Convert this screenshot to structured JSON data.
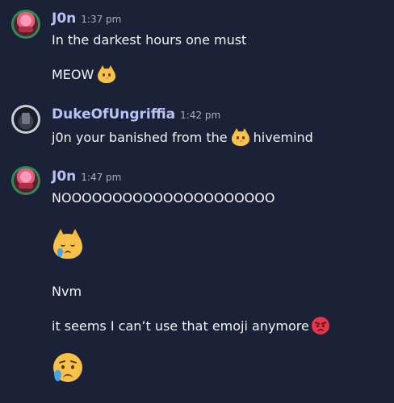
{
  "colors": {
    "background": "#1b2238",
    "username": "#b7c3f3",
    "timestamp": "#aab0bd",
    "text": "#f2f3f5"
  },
  "messages": [
    {
      "username": "J0n",
      "time": "1:37 pm",
      "avatar_icon": "pink-avatar",
      "lines": [
        {
          "text": "In the darkest hours one must"
        },
        {
          "text": "MEOW",
          "emoji": "grinning-cat-emoji"
        }
      ]
    },
    {
      "username": "DukeOfUngriffia",
      "time": "1:42 pm",
      "avatar_icon": "dark-avatar",
      "lines": [
        {
          "text_before": "j0n your banished from the",
          "emoji": "grinning-cat-emoji",
          "text_after": "hivemind"
        }
      ]
    },
    {
      "username": "J0n",
      "time": "1:47 pm",
      "avatar_icon": "pink-avatar",
      "lines": [
        {
          "text": "NOOOOOOOOOOOOOOOOOOOOO"
        },
        {
          "emoji": "crying-cat-emoji"
        },
        {
          "text": "Nvm"
        },
        {
          "text": "it seems I can’t use that emoji anymore",
          "emoji": "angry-face-emoji"
        },
        {
          "emoji": "sad-tear-face-emoji"
        }
      ]
    }
  ]
}
